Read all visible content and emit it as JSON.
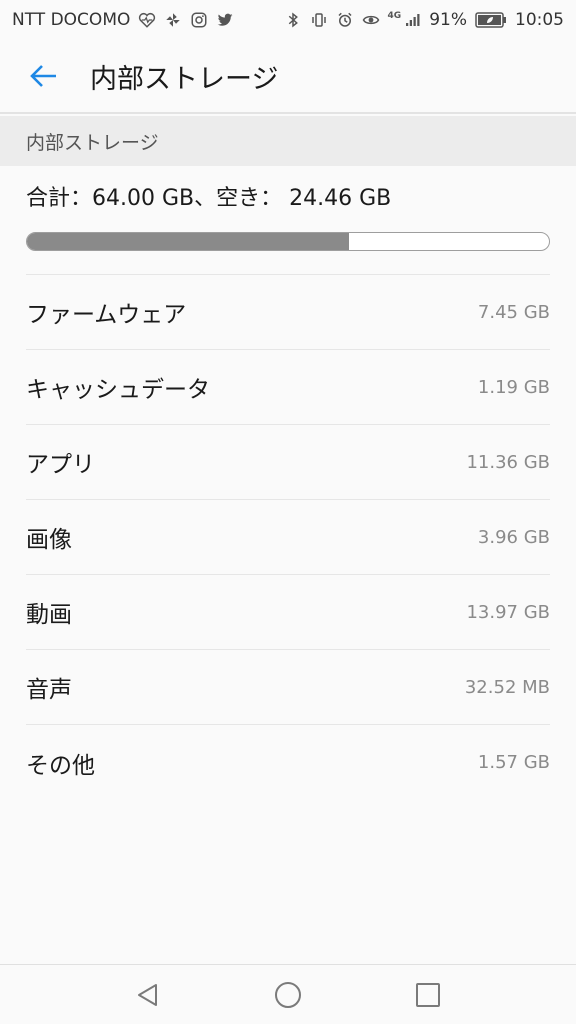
{
  "status_bar": {
    "carrier": "NTT DOCOMO",
    "network": "4G",
    "battery": "91%",
    "time": "10:05",
    "left_icons": [
      "heart-rate-icon",
      "pinwheel-icon",
      "instagram-icon",
      "twitter-icon"
    ],
    "right_icons": [
      "bluetooth-icon",
      "vibrate-icon",
      "alarm-icon",
      "eye-icon",
      "signal-icon",
      "battery-icon"
    ]
  },
  "header": {
    "title": "内部ストレージ",
    "back_icon": "back-arrow-icon",
    "accent_color": "#1e88e5"
  },
  "storage": {
    "section_title": "内部ストレージ",
    "summary": "合計：64.00 GB、空き： 24.46 GB",
    "used_fraction": 0.6178,
    "bar_color": "#8a8a8a"
  },
  "items": [
    {
      "label": "ファームウェア",
      "value": "7.45 GB"
    },
    {
      "label": "キャッシュデータ",
      "value": "1.19 GB"
    },
    {
      "label": "アプリ",
      "value": "11.36 GB"
    },
    {
      "label": "画像",
      "value": "3.96 GB"
    },
    {
      "label": "動画",
      "value": "13.97 GB"
    },
    {
      "label": "音声",
      "value": "32.52 MB"
    },
    {
      "label": "その他",
      "value": "1.57 GB"
    }
  ],
  "nav_bar": {
    "icons": [
      "back-triangle-icon",
      "home-circle-icon",
      "recents-square-icon"
    ]
  }
}
